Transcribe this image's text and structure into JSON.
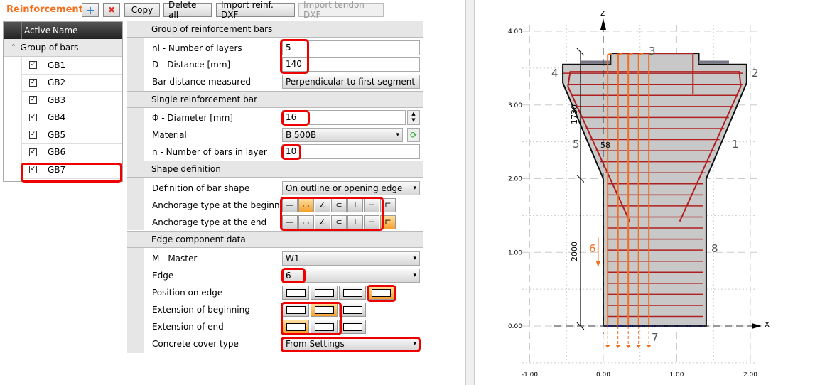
{
  "header": {
    "title": "Reinforcement",
    "add": "+",
    "delete": "✖",
    "copy": "Copy",
    "delete_all": "Delete all",
    "import_reinf": "Import reinf. DXF",
    "import_tendon": "Import tendon DXF"
  },
  "list": {
    "col_active": "Active",
    "col_name": "Name",
    "group": "Group of bars",
    "items": [
      {
        "name": "GB1",
        "active": true
      },
      {
        "name": "GB2",
        "active": true
      },
      {
        "name": "GB3",
        "active": true
      },
      {
        "name": "GB4",
        "active": true
      },
      {
        "name": "GB5",
        "active": true
      },
      {
        "name": "GB6",
        "active": true
      },
      {
        "name": "GB7",
        "active": true,
        "selected": true
      }
    ]
  },
  "props": {
    "s1": "Group of reinforcement bars",
    "nl_label": "nl - Number of layers",
    "nl": "5",
    "d_label": "D - Distance [mm]",
    "d": "140",
    "measured_label": "Bar distance measured",
    "measured": "Perpendicular to first segment +",
    "s2": "Single reinforcement bar",
    "dia_label": "Φ - Diameter [mm]",
    "dia": "16",
    "mat_label": "Material",
    "mat": "B 500B",
    "n_label": "n - Number of bars in layer",
    "n": "10",
    "s3": "Shape definition",
    "shape_label": "Definition of bar shape",
    "shape": "On outline or opening edge",
    "anch_begin_label": "Anchorage type at the beginning",
    "anch_end_label": "Anchorage type at the end",
    "anch_begin_selected": 1,
    "anch_end_selected": 6,
    "s4": "Edge component data",
    "master_label": "M - Master",
    "master": "W1",
    "edge_label": "Edge",
    "edge": "6",
    "pos_label": "Position on edge",
    "pos_selected": 3,
    "ext_begin_label": "Extension of beginning",
    "ext_begin_selected": 1,
    "ext_end_label": "Extension of end",
    "ext_end_selected": 0,
    "cover_label": "Concrete cover type",
    "cover": "From Settings"
  },
  "drawing": {
    "axis_x": "x",
    "axis_z": "z",
    "x_ticks": [
      "-1.00",
      "0.00",
      "1.00",
      "2.00"
    ],
    "z_ticks": [
      "0.00",
      "1.00",
      "2.00",
      "3.00",
      "4.00"
    ],
    "edge_labels": [
      "1",
      "2",
      "3",
      "4",
      "5",
      "6",
      "7",
      "8"
    ],
    "dim_1730": "1730",
    "dim_2000": "2000",
    "dim_58": "58"
  },
  "colors": {
    "accent": "#f07020",
    "rebar": "#b02020",
    "selected_rebar": "#f07020",
    "highlight": "#e00000"
  }
}
